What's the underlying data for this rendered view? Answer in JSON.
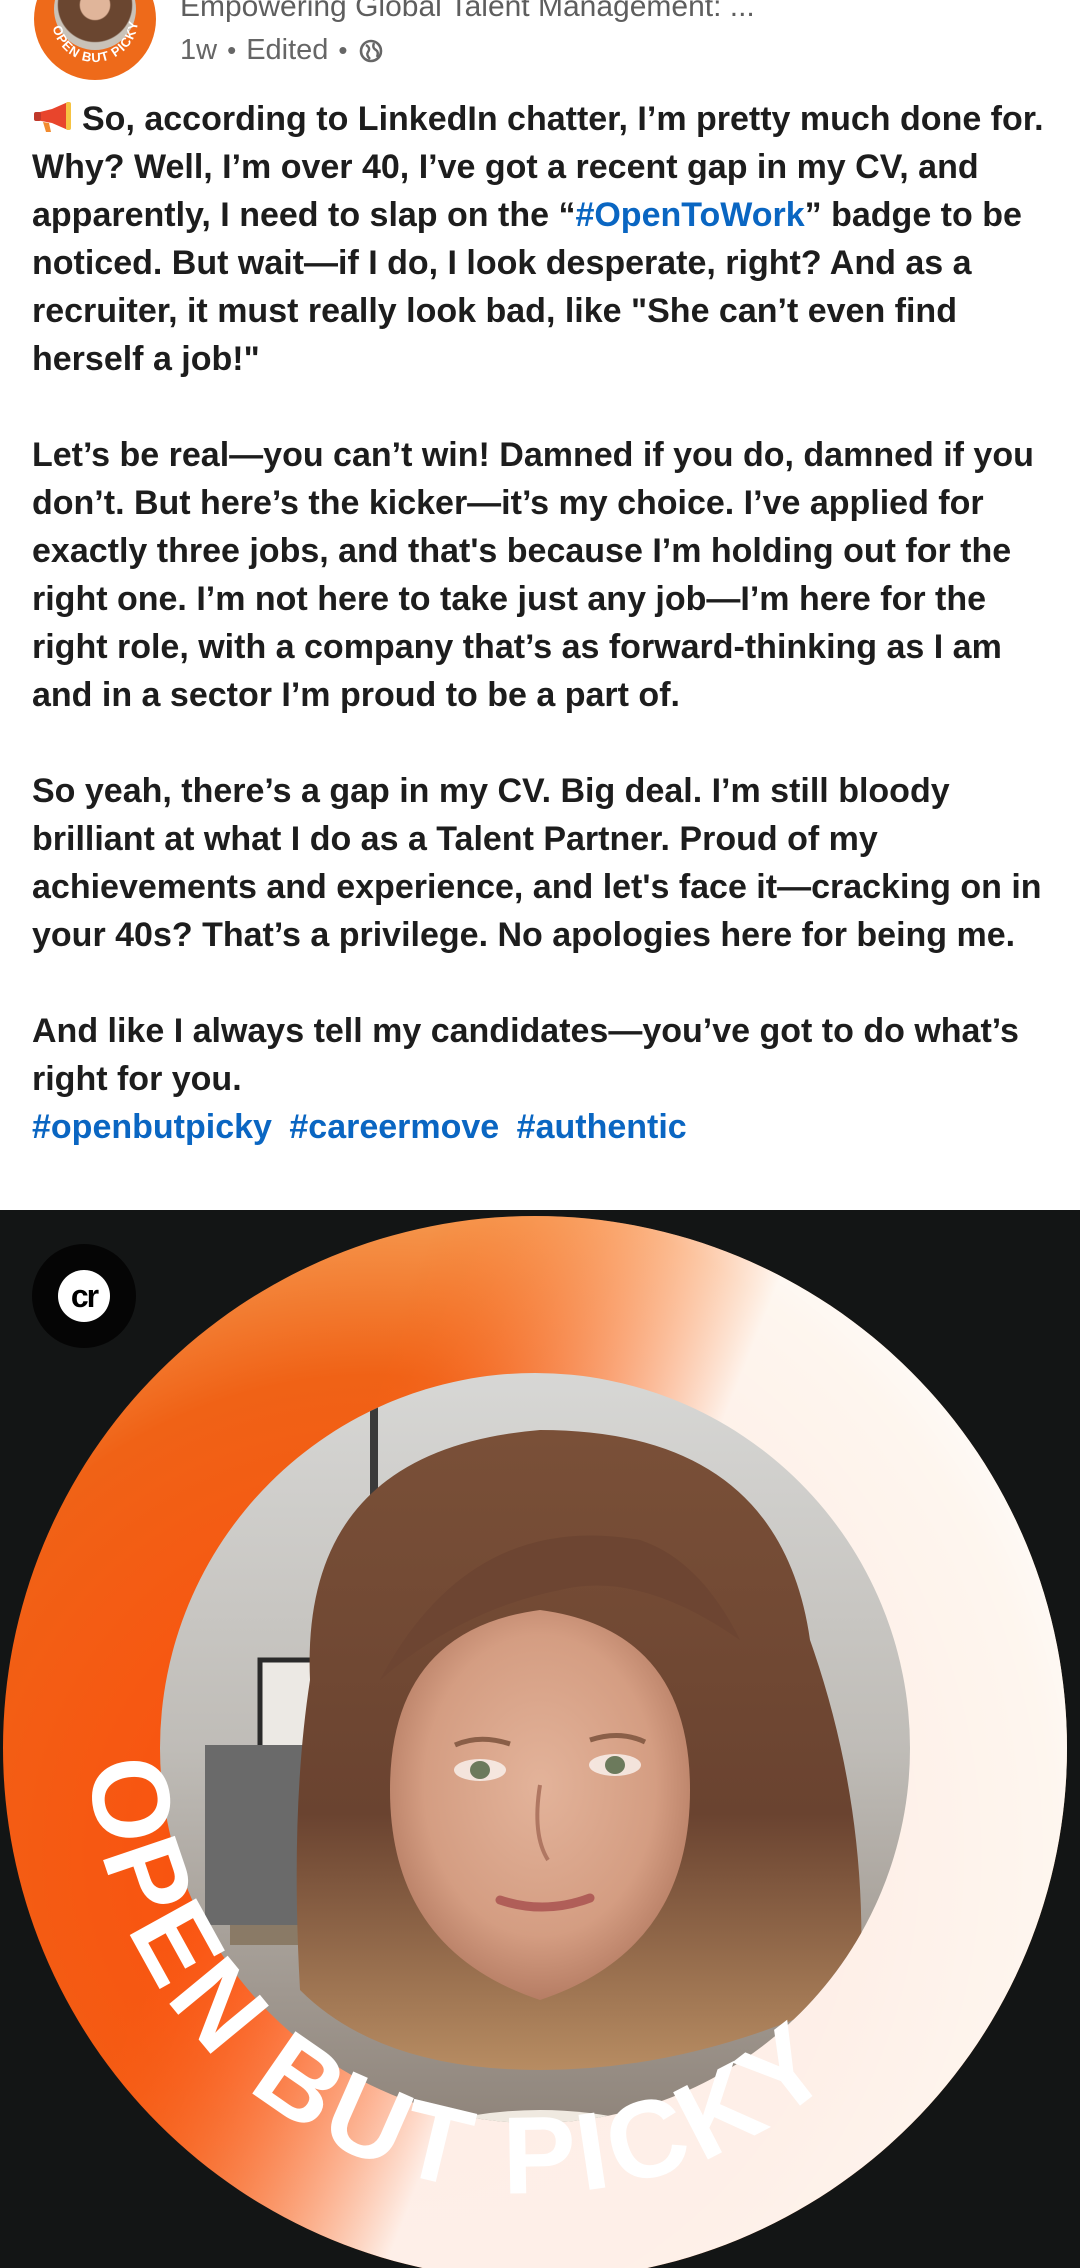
{
  "header": {
    "org_title": "Empowering Global Talent Management: ...",
    "age": "1w",
    "edited": "Edited",
    "separator": "•",
    "avatar_ring_text": "OPEN BUT PICKY"
  },
  "post": {
    "paragraph_1_before": "So, according to LinkedIn chatter, I’m pretty much done for. Why? Well, I’m over 40,  I’ve got a recent gap in my CV, and apparently, I need to slap on the “",
    "paragraph_1_hashtag": "#OpenToWork",
    "paragraph_1_after": "” badge to be noticed. But wait—if I do, I look desperate, right? And as a recruiter, it must really look bad, like \"She can’t even find herself a job!\"",
    "paragraph_2": "Let’s be real—you can’t win! Damned if you do, damned if you don’t. But here’s the kicker—it’s my choice. I’ve applied for exactly three jobs, and that's because I’m holding out for the right one. I’m not here to take just any job—I’m here for the right role, with a company that’s as forward-thinking as I am and in a sector I’m proud to be a part of.",
    "paragraph_3": "So yeah, there’s a gap in my CV. Big deal. I’m still bloody brilliant at what I do as a Talent Partner. Proud of my achievements and experience, and let's face it—cracking on in your 40s? That’s a privilege. No apologies here for being me.",
    "paragraph_4": "And like I always tell my candidates—you’ve got to do what’s right for you.",
    "hashtags": [
      "#openbutpicky",
      "#careermove",
      "#authentic"
    ]
  },
  "image": {
    "badge_text": "cr",
    "frame_text": "OPEN BUT PICKY"
  },
  "colors": {
    "accent_orange": "#ee5a14",
    "link_blue": "#0a66c2",
    "image_background": "#131515"
  }
}
